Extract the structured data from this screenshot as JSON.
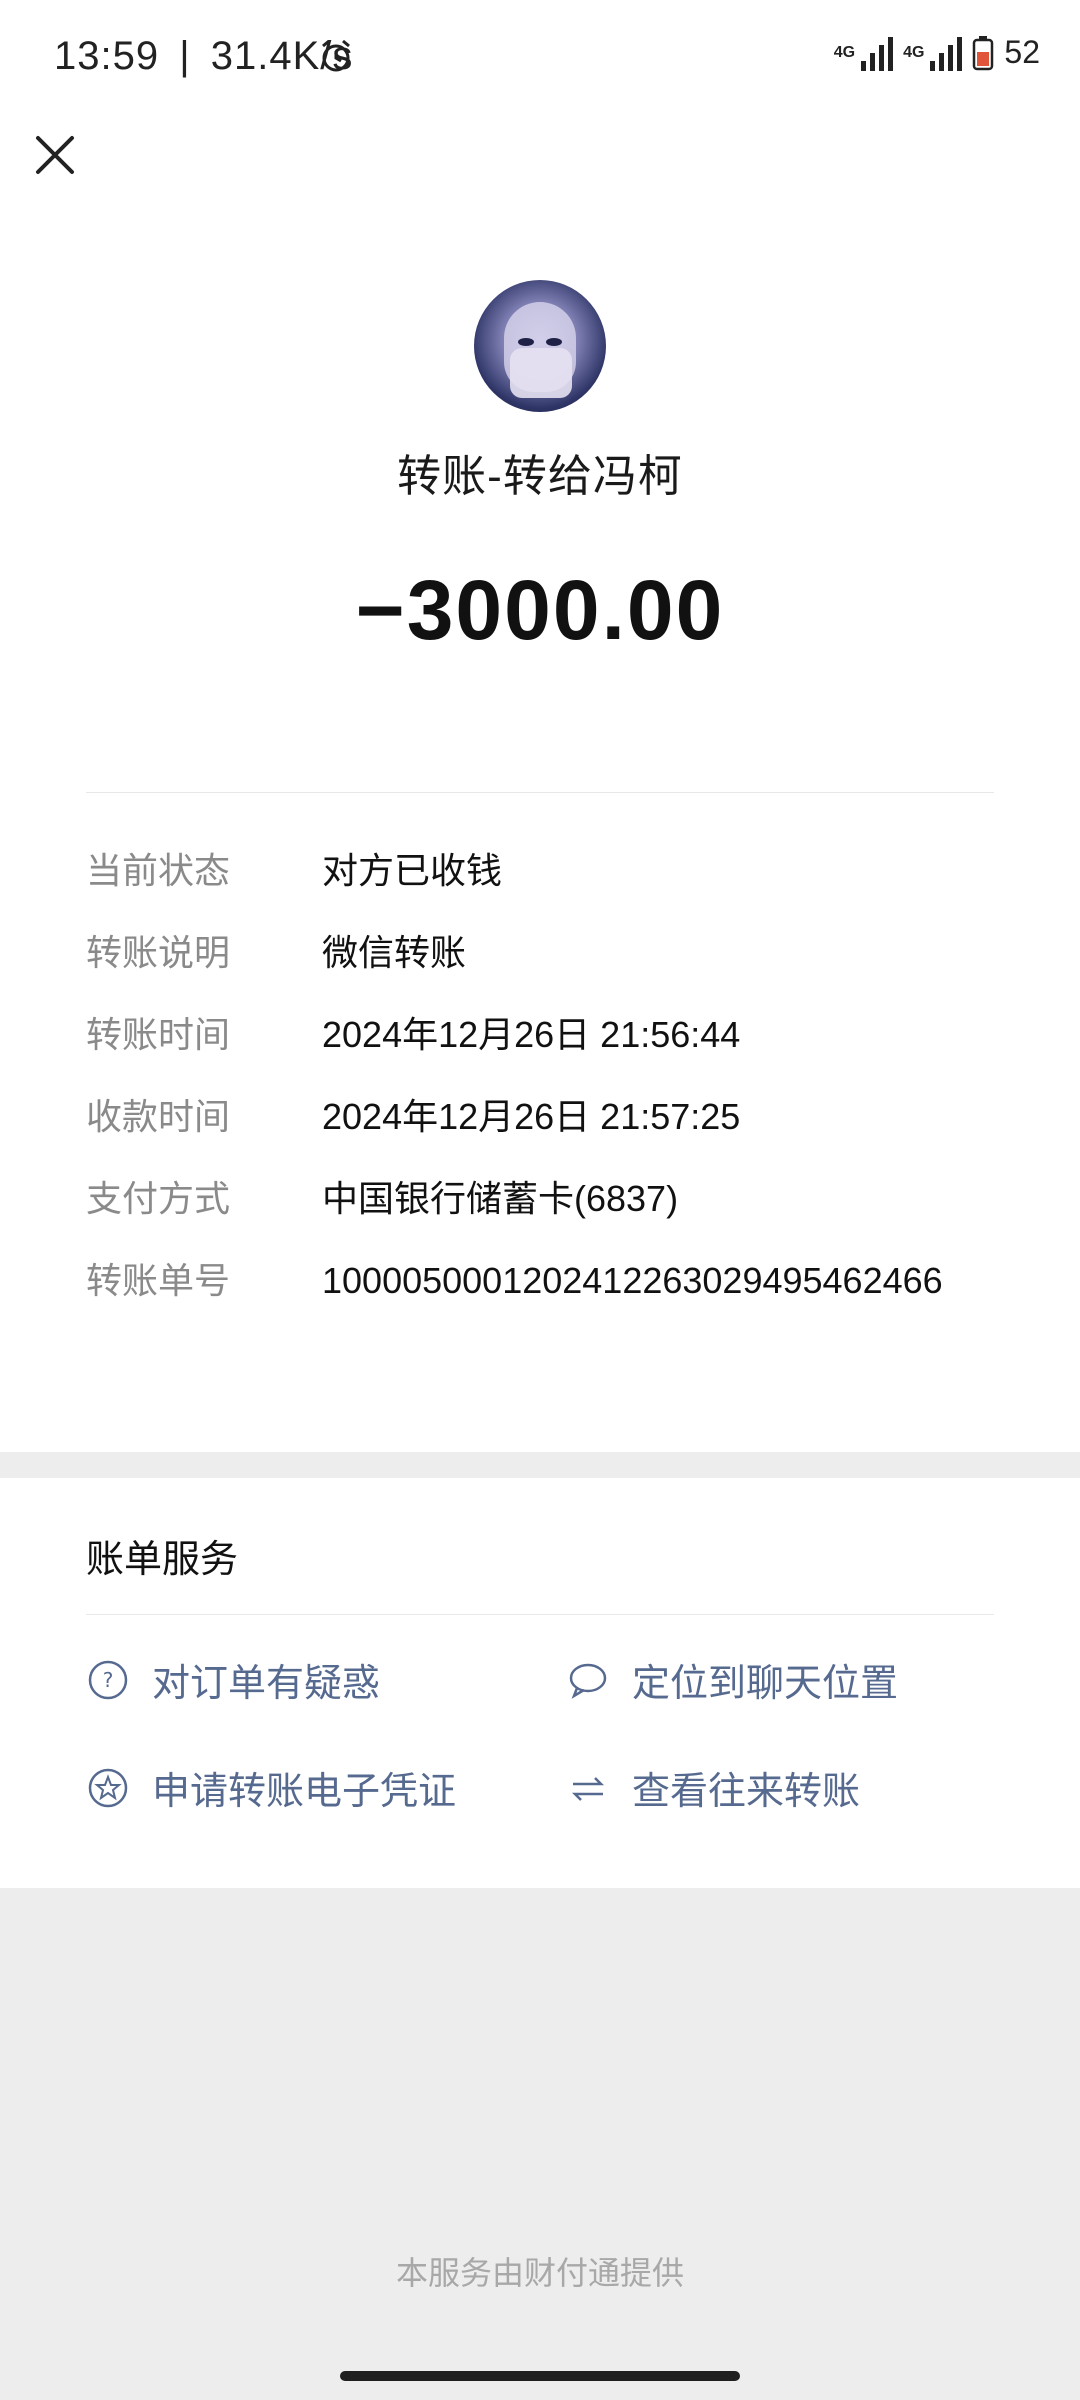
{
  "status_bar": {
    "time": "13:59",
    "speed": "31.4K/s",
    "network1": "4G",
    "network2": "4G",
    "battery": "52"
  },
  "transfer": {
    "title": "转账-转给冯柯",
    "amount": "−3000.00"
  },
  "details": [
    {
      "label": "当前状态",
      "value": "对方已收钱"
    },
    {
      "label": "转账说明",
      "value": "微信转账"
    },
    {
      "label": "转账时间",
      "value": "2024年12月26日  21:56:44"
    },
    {
      "label": "收款时间",
      "value": "2024年12月26日  21:57:25"
    },
    {
      "label": "支付方式",
      "value": "中国银行储蓄卡(6837)"
    },
    {
      "label": "转账单号",
      "value": "1000050001202412263029495462466"
    }
  ],
  "services": {
    "title": "账单服务",
    "items": [
      {
        "label": "对订单有疑惑",
        "icon": "question-circle-icon"
      },
      {
        "label": "定位到聊天位置",
        "icon": "chat-bubble-icon"
      },
      {
        "label": "申请转账电子凭证",
        "icon": "star-circle-icon"
      },
      {
        "label": "查看往来转账",
        "icon": "exchange-arrows-icon"
      }
    ]
  },
  "footer": "本服务由财付通提供",
  "colors": {
    "link": "#56698f",
    "label_gray": "#8a8a8a",
    "background": "#ededed"
  }
}
